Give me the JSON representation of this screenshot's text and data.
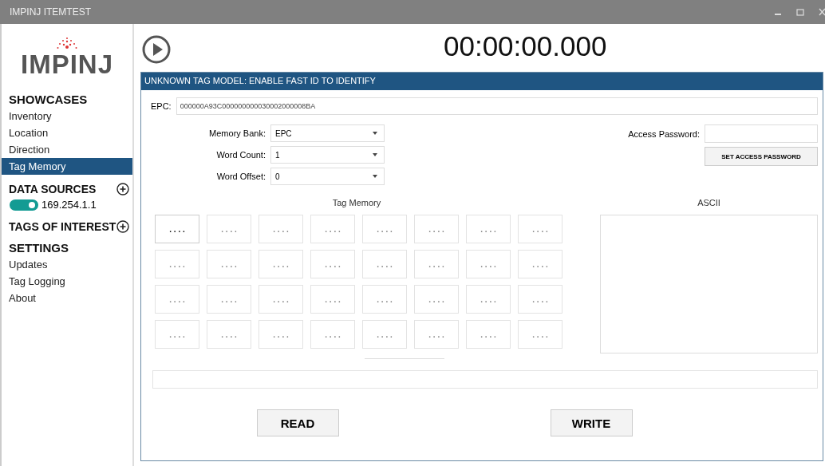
{
  "window": {
    "title": "IMPINJ ITEMTEST"
  },
  "sidebar": {
    "logo": "IMPINJ",
    "showcases": {
      "title": "SHOWCASES",
      "items": [
        {
          "label": "Inventory",
          "selected": false
        },
        {
          "label": "Location",
          "selected": false
        },
        {
          "label": "Direction",
          "selected": false
        },
        {
          "label": "Tag Memory",
          "selected": true
        }
      ]
    },
    "data_sources": {
      "title": "DATA SOURCES",
      "sources": [
        {
          "label": "169.254.1.1",
          "on": true
        }
      ]
    },
    "tags_of_interest": {
      "title": "TAGS OF INTEREST"
    },
    "settings": {
      "title": "SETTINGS",
      "items": [
        {
          "label": "Updates"
        },
        {
          "label": "Tag Logging"
        },
        {
          "label": "About"
        }
      ]
    }
  },
  "timer": "00:00:00.000",
  "panel": {
    "header": "UNKNOWN TAG MODEL: ENABLE FAST ID TO IDENTIFY",
    "epc": {
      "label": "EPC:",
      "value": "000000A93C000000000030002000008BA"
    },
    "selects": [
      {
        "label": "Memory Bank:",
        "value": "EPC"
      },
      {
        "label": "Word Count:",
        "value": "1"
      },
      {
        "label": "Word Offset:",
        "value": "0"
      }
    ],
    "access_password": {
      "label": "Access Password:"
    },
    "set_password_button": "SET ACCESS PASSWORD",
    "tag_memory_title": "Tag Memory",
    "ascii_title": "ASCII",
    "cells": [
      {
        "value": ". . . .",
        "selected": true
      },
      {
        "value": ". . . .",
        "selected": false
      },
      {
        "value": ". . . .",
        "selected": false
      },
      {
        "value": ". . . .",
        "selected": false
      },
      {
        "value": ". . . .",
        "selected": false
      },
      {
        "value": ". . . .",
        "selected": false
      },
      {
        "value": ". . . .",
        "selected": false
      },
      {
        "value": ". . . .",
        "selected": false
      },
      {
        "value": ". . . .",
        "selected": false
      },
      {
        "value": ". . . .",
        "selected": false
      },
      {
        "value": ". . . .",
        "selected": false
      },
      {
        "value": ". . . .",
        "selected": false
      },
      {
        "value": ". . . .",
        "selected": false
      },
      {
        "value": ". . . .",
        "selected": false
      },
      {
        "value": ". . . .",
        "selected": false
      },
      {
        "value": ". . . .",
        "selected": false
      },
      {
        "value": ". . . .",
        "selected": false
      },
      {
        "value": ". . . .",
        "selected": false
      },
      {
        "value": ". . . .",
        "selected": false
      },
      {
        "value": ". . . .",
        "selected": false
      },
      {
        "value": ". . . .",
        "selected": false
      },
      {
        "value": ". . . .",
        "selected": false
      },
      {
        "value": ". . . .",
        "selected": false
      },
      {
        "value": ". . . .",
        "selected": false
      },
      {
        "value": ". . . .",
        "selected": false
      },
      {
        "value": ". . . .",
        "selected": false
      },
      {
        "value": ". . . .",
        "selected": false
      },
      {
        "value": ". . . .",
        "selected": false
      },
      {
        "value": ". . . .",
        "selected": false
      },
      {
        "value": ". . . .",
        "selected": false
      },
      {
        "value": ". . . .",
        "selected": false
      },
      {
        "value": ". . . .",
        "selected": false
      }
    ],
    "buttons": [
      "READ",
      "WRITE"
    ]
  }
}
